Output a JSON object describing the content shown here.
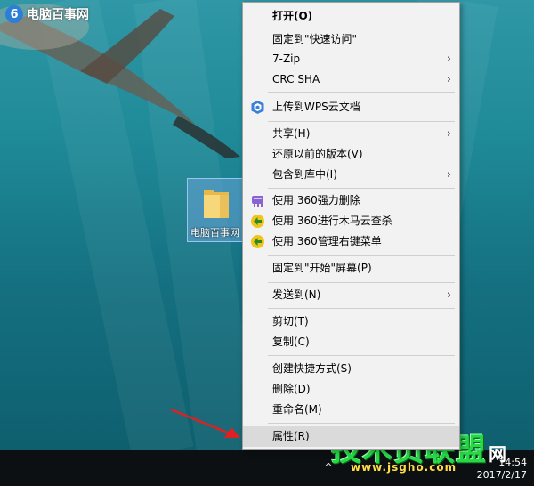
{
  "watermark_top": {
    "text": "电脑百事网"
  },
  "desktop_icon": {
    "label": "电脑百事网"
  },
  "context_menu": {
    "items": [
      {
        "label": "打开(O)",
        "bold": true
      },
      {
        "label": "固定到\"快速访问\""
      },
      {
        "label": "7-Zip",
        "submenu": true
      },
      {
        "label": "CRC SHA",
        "submenu": true
      },
      {
        "label": "上传到WPS云文档",
        "icon": "wps-cloud-icon"
      },
      {
        "label": "共享(H)",
        "submenu": true
      },
      {
        "label": "还原以前的版本(V)"
      },
      {
        "label": "包含到库中(I)",
        "submenu": true
      },
      {
        "label": "使用 360强力删除",
        "icon": "360-shred-icon"
      },
      {
        "label": "使用 360进行木马云查杀",
        "icon": "360-scan-icon"
      },
      {
        "label": "使用 360管理右键菜单",
        "icon": "360-menu-icon"
      },
      {
        "label": "固定到\"开始\"屏幕(P)"
      },
      {
        "label": "发送到(N)",
        "submenu": true
      },
      {
        "label": "剪切(T)"
      },
      {
        "label": "复制(C)"
      },
      {
        "label": "创建快捷方式(S)"
      },
      {
        "label": "删除(D)"
      },
      {
        "label": "重命名(M)"
      },
      {
        "label": "属性(R)",
        "highlighted": true
      }
    ],
    "submenu_glyph": "›"
  },
  "taskbar": {
    "tray_glyph": "^",
    "time": "14:54",
    "date": "2017/2/17"
  },
  "watermark_bottom": {
    "title": "技术员联盟",
    "suffix": "网",
    "url": "www.jsgho.com"
  },
  "colors": {
    "menu_bg": "#f2f2f2",
    "highlight": "#dadada",
    "watermark_green": "#27d847",
    "annotation_red": "#e02020"
  }
}
